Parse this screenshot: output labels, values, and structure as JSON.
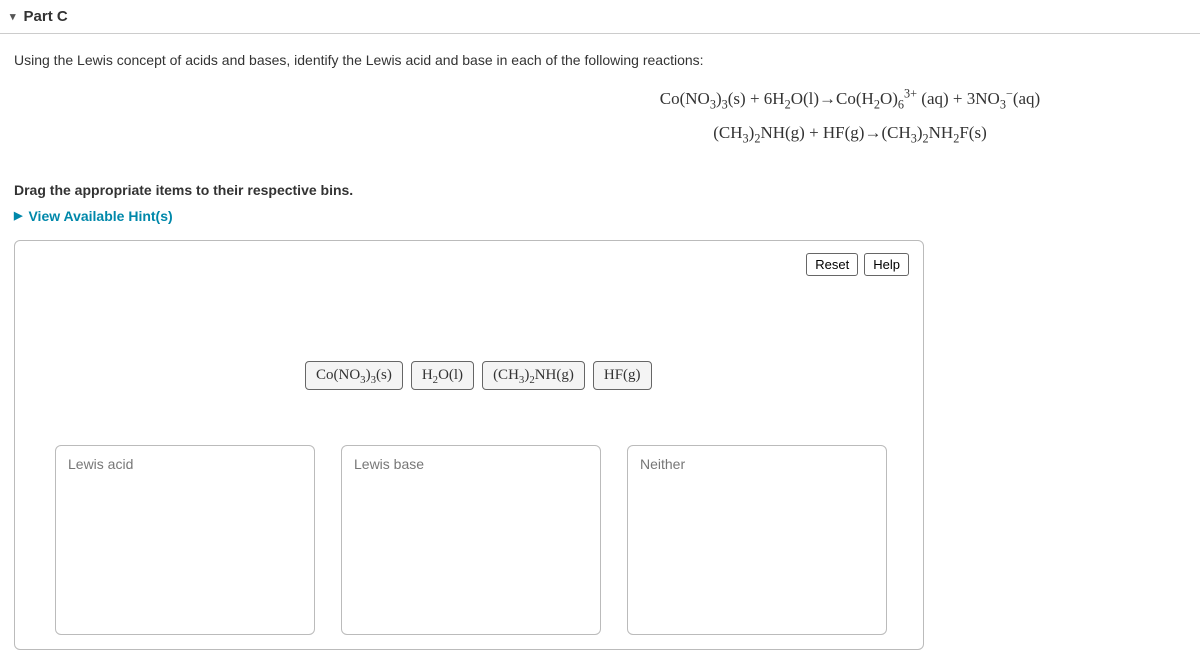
{
  "part_label": "Part C",
  "question": "Using the Lewis concept of acids and bases, identify the Lewis acid and base in each of the following reactions:",
  "equations": {
    "eq1": "Co(NO<sub>3</sub>)<sub>3</sub>(s) + 6H<sub>2</sub>O(l)→Co(H<sub>2</sub>O)<sub>6</sub><sup>3+</sup> (aq) + 3NO<sub>3</sub><sup>−</sup>(aq)",
    "eq2": "(CH<sub>3</sub>)<sub>2</sub>NH(g) + HF(g)→(CH<sub>3</sub>)<sub>2</sub>NH<sub>2</sub>F(s)"
  },
  "instruction": "Drag the appropriate items to their respective bins.",
  "hints_label": "View Available Hint(s)",
  "buttons": {
    "reset": "Reset",
    "help": "Help"
  },
  "draggables": [
    "Co(NO<sub>3</sub>)<sub>3</sub>(s)",
    "H<sub>2</sub>O(l)",
    "(CH<sub>3</sub>)<sub>2</sub>NH(g)",
    "HF(g)"
  ],
  "bins": [
    "Lewis acid",
    "Lewis base",
    "Neither"
  ]
}
